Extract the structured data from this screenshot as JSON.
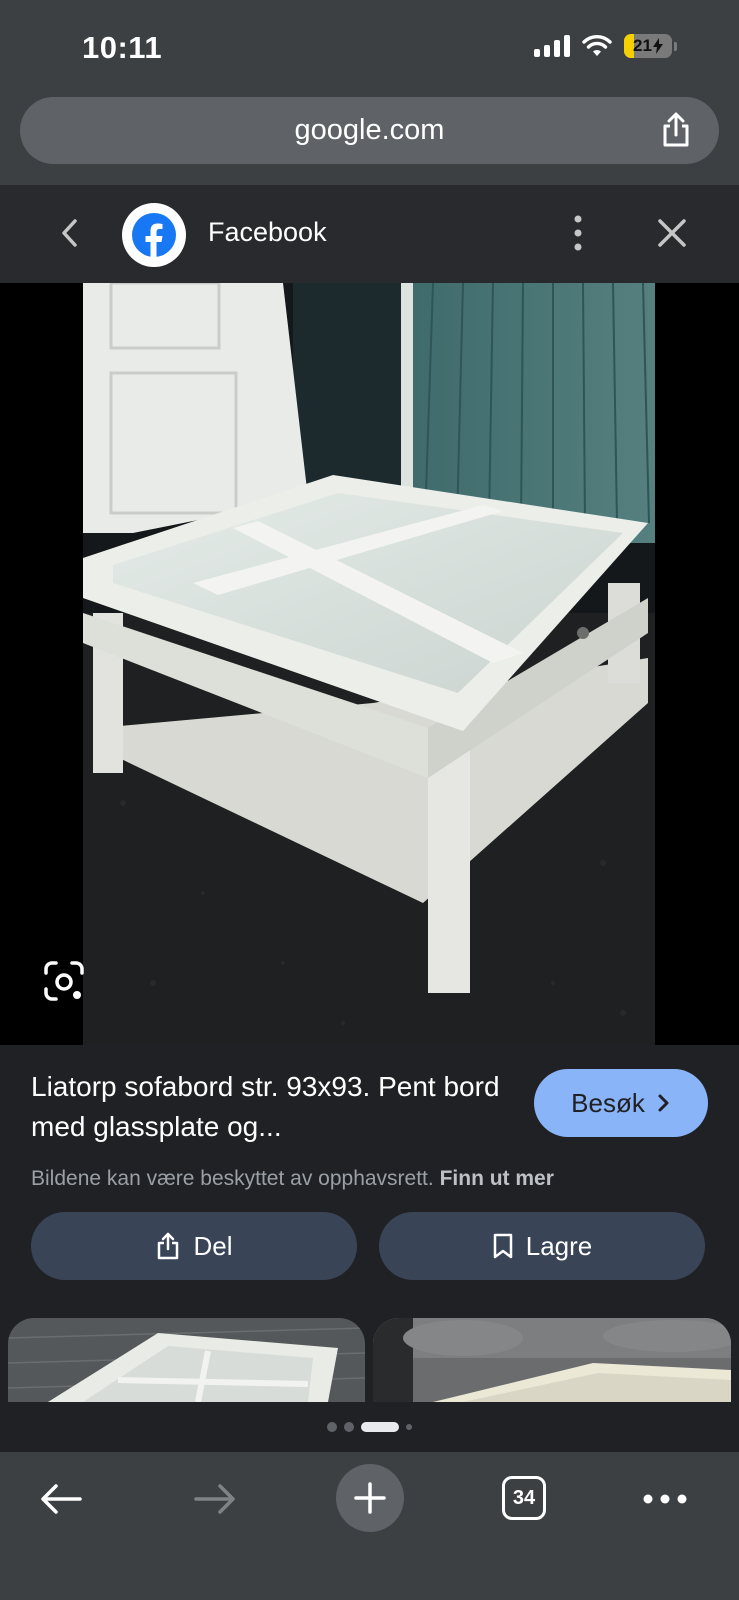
{
  "status_bar": {
    "time": "10:11",
    "battery": "21",
    "icons": [
      "signal-icon",
      "wifi-icon",
      "battery-charging-icon"
    ]
  },
  "url_bar": {
    "domain": "google.com",
    "share_icon": "share-icon"
  },
  "source": {
    "name": "Facebook",
    "back_icon": "chevron-left-icon",
    "more_icon": "more-vert-icon",
    "close_icon": "close-icon"
  },
  "result": {
    "title": "Liatorp sofabord str. 93x93. Pent bord med glassplate og...",
    "visit_label": "Besøk",
    "copyright_text": "Bildene kan være beskyttet av opphavsrett.",
    "learn_more_label": "Finn ut mer",
    "share_label": "Del",
    "save_label": "Lagre"
  },
  "carousel": {
    "dot_count": 4,
    "active_index": 2
  },
  "toolbar": {
    "tab_count": "34",
    "icons": [
      "arrow-left-icon",
      "arrow-right-icon",
      "plus-icon",
      "tabs-icon",
      "more-horiz-icon"
    ]
  },
  "colors": {
    "accent": "#8ab4f8",
    "action_button": "#394457",
    "background": "#202124"
  }
}
